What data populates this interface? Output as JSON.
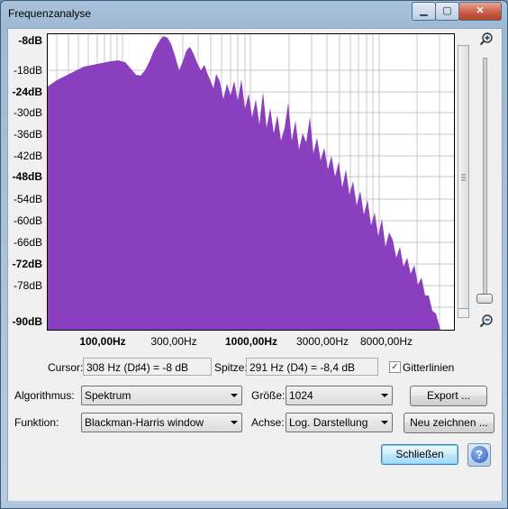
{
  "window": {
    "title": "Frequenzanalyse",
    "minimize_icon": "minimize-icon",
    "maximize_icon": "maximize-icon",
    "close_icon": "close-icon"
  },
  "plot": {
    "y_labels": [
      "-8dB",
      "-18dB",
      "-24dB",
      "-30dB",
      "-36dB",
      "-42dB",
      "-48dB",
      "-54dB",
      "-60dB",
      "-66dB",
      "-72dB",
      "-78dB",
      "-90dB"
    ],
    "x_labels": [
      "100,00Hz",
      "300,00Hz",
      "1000,00Hz",
      "3000,00Hz",
      "8000,00Hz"
    ],
    "fill_color": "#8a3fbf",
    "zoom_in_icon": "zoom-in-icon",
    "zoom_out_icon": "zoom-out-icon"
  },
  "cursor": {
    "label": "Cursor:",
    "value": "308 Hz (D♯4) = -8 dB"
  },
  "peak": {
    "label": "Spitze:",
    "value": "291 Hz (D4) = -8,4 dB"
  },
  "gridlines": {
    "label": "Gitterlinien",
    "checked": true
  },
  "algorithm": {
    "label": "Algorithmus:",
    "value": "Spektrum"
  },
  "size": {
    "label": "Größe:",
    "value": "1024"
  },
  "function": {
    "label": "Funktion:",
    "value": "Blackman-Harris window"
  },
  "axis": {
    "label": "Achse:",
    "value": "Log. Darstellung"
  },
  "buttons": {
    "export": "Export ...",
    "redraw": "Neu zeichnen ...",
    "close": "Schließen",
    "help_icon": "help-icon"
  }
}
